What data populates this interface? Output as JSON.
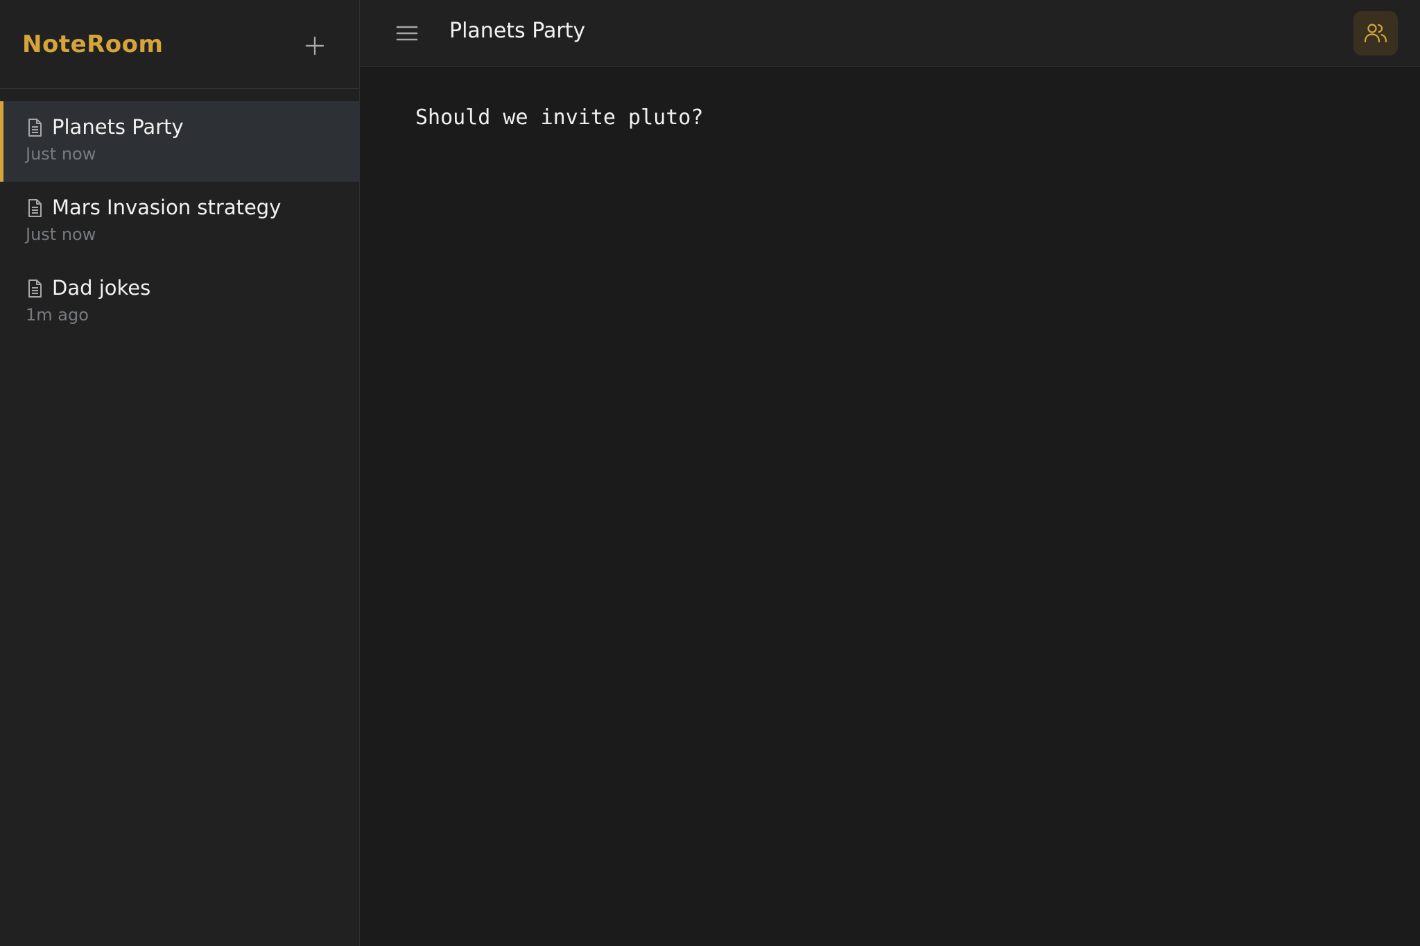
{
  "app": {
    "name": "NoteRoom",
    "accent_color": "#d6a53a"
  },
  "sidebar": {
    "new_note_icon": "plus-icon",
    "notes": [
      {
        "title": "Planets Party",
        "time": "Just now",
        "icon": "document-icon",
        "active": true
      },
      {
        "title": "Mars Invasion strategy",
        "time": "Just now",
        "icon": "document-icon",
        "active": false
      },
      {
        "title": "Dad jokes",
        "time": "1m ago",
        "icon": "document-icon",
        "active": false
      }
    ]
  },
  "topbar": {
    "menu_icon": "hamburger-menu-icon",
    "title": "Planets Party",
    "collaborators_icon": "users-icon"
  },
  "editor": {
    "content": "Should we invite pluto?"
  }
}
